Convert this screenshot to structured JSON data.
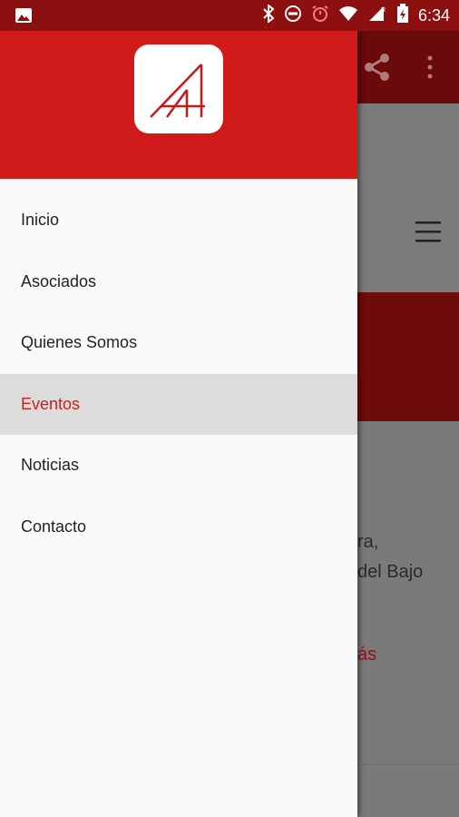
{
  "status_bar": {
    "time": "6:34",
    "icons": [
      "image-icon",
      "bluetooth-icon",
      "do-not-disturb-icon",
      "alarm-icon",
      "wifi-icon",
      "signal-icon",
      "battery-icon"
    ],
    "background": "#8c1010"
  },
  "drawer": {
    "header_color": "#d11a1a",
    "logo": "AA-logo",
    "items": [
      {
        "label": "Inicio",
        "active": false
      },
      {
        "label": "Asociados",
        "active": false
      },
      {
        "label": "Quienes Somos",
        "active": false
      },
      {
        "label": "Eventos",
        "active": true
      },
      {
        "label": "Noticias",
        "active": false
      },
      {
        "label": "Contacto",
        "active": false
      }
    ],
    "active_color": "#cc1f1f"
  },
  "background_app": {
    "text_line1": "ra,",
    "text_line2": "del Bajo",
    "link_text": "ás"
  }
}
